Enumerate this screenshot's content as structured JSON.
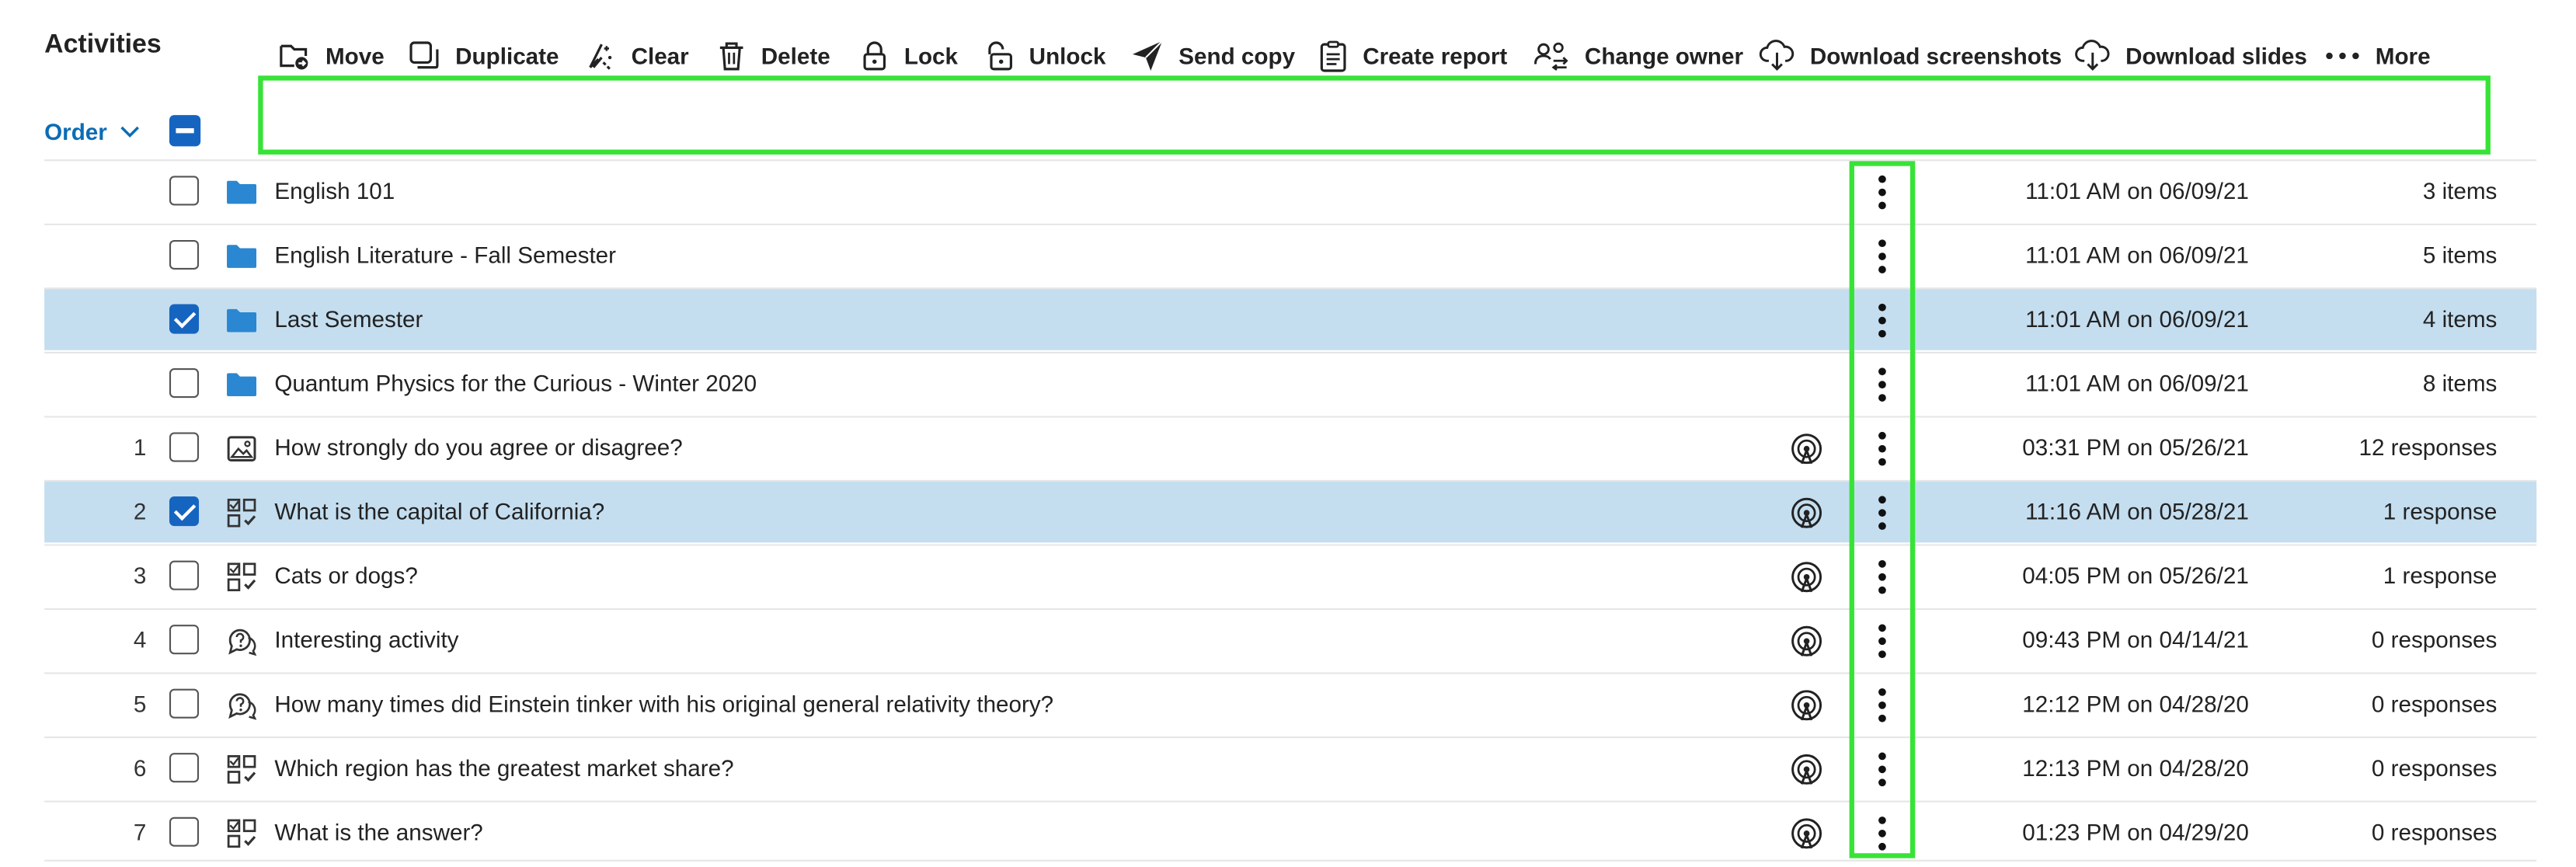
{
  "page": {
    "title": "Activities"
  },
  "sort": {
    "label": "Order"
  },
  "toolbar": {
    "move": "Move",
    "duplicate": "Duplicate",
    "clear": "Clear",
    "delete": "Delete",
    "lock": "Lock",
    "unlock": "Unlock",
    "send_copy": "Send copy",
    "create_report": "Create report",
    "change_owner": "Change owner",
    "download_screenshots": "Download screenshots",
    "download_slides": "Download slides",
    "more": "More"
  },
  "colors": {
    "accent": "#1565c0",
    "link": "#0b6cb5",
    "selected_row": "#c4def0",
    "highlight": "#37e337",
    "folder": "#2b87d1"
  },
  "rows": [
    {
      "order": "",
      "type": "folder",
      "icon": "folder-icon",
      "name": "English 101",
      "live": false,
      "date": "11:01 AM on 06/09/21",
      "count": "3 items",
      "selected": false
    },
    {
      "order": "",
      "type": "folder",
      "icon": "folder-icon",
      "name": "English Literature - Fall Semester",
      "live": false,
      "date": "11:01 AM on 06/09/21",
      "count": "5 items",
      "selected": false
    },
    {
      "order": "",
      "type": "folder",
      "icon": "folder-icon",
      "name": "Last Semester",
      "live": false,
      "date": "11:01 AM on 06/09/21",
      "count": "4 items",
      "selected": true
    },
    {
      "order": "",
      "type": "folder",
      "icon": "folder-icon",
      "name": "Quantum Physics for the Curious - Winter 2020",
      "live": false,
      "date": "11:01 AM on 06/09/21",
      "count": "8 items",
      "selected": false
    },
    {
      "order": "1",
      "type": "image",
      "icon": "image-icon",
      "name": "How strongly do you agree or disagree?",
      "live": true,
      "date": "03:31 PM on 05/26/21",
      "count": "12 responses",
      "selected": false
    },
    {
      "order": "2",
      "type": "multiple-choice",
      "icon": "multiple-choice-icon",
      "name": "What is the capital of California?",
      "live": true,
      "date": "11:16 AM on 05/28/21",
      "count": "1 response",
      "selected": true
    },
    {
      "order": "3",
      "type": "multiple-choice",
      "icon": "multiple-choice-icon",
      "name": "Cats or dogs?",
      "live": true,
      "date": "04:05 PM on 05/26/21",
      "count": "1 response",
      "selected": false
    },
    {
      "order": "4",
      "type": "qa",
      "icon": "qa-icon",
      "name": "Interesting activity",
      "live": true,
      "date": "09:43 PM on 04/14/21",
      "count": "0 responses",
      "selected": false
    },
    {
      "order": "5",
      "type": "qa",
      "icon": "qa-icon",
      "name": "How many times did Einstein tinker with his original general relativity theory?",
      "live": true,
      "date": "12:12 PM on 04/28/20",
      "count": "0 responses",
      "selected": false
    },
    {
      "order": "6",
      "type": "multiple-choice",
      "icon": "multiple-choice-icon",
      "name": "Which region has the greatest market share?",
      "live": true,
      "date": "12:13 PM on 04/28/20",
      "count": "0 responses",
      "selected": false
    },
    {
      "order": "7",
      "type": "multiple-choice",
      "icon": "multiple-choice-icon",
      "name": "What is the answer?",
      "live": true,
      "date": "01:23 PM on 04/29/20",
      "count": "0 responses",
      "selected": false
    }
  ]
}
